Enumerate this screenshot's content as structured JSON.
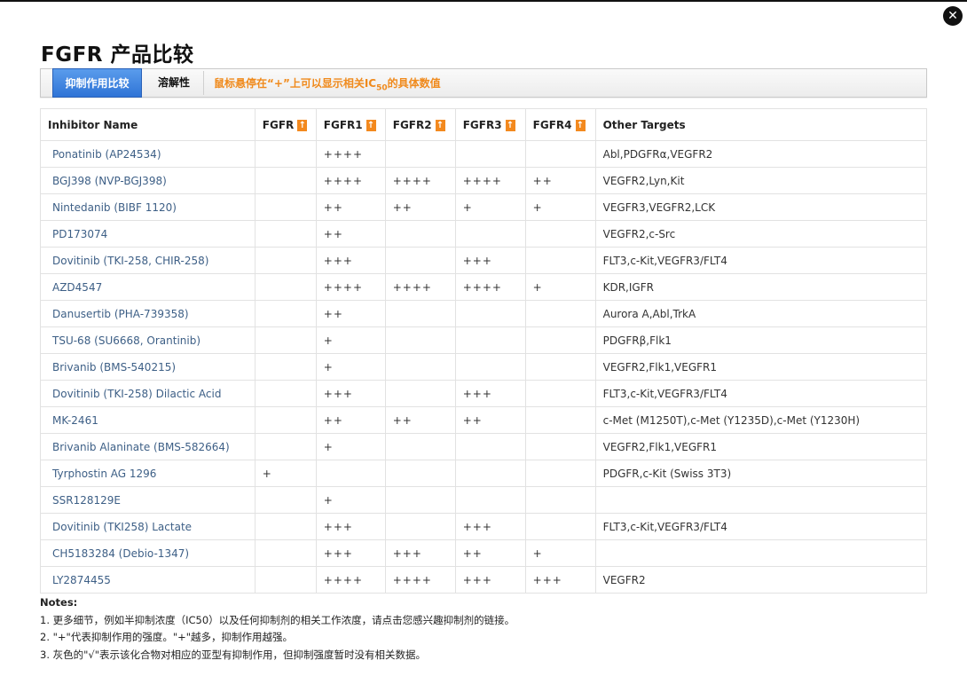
{
  "title": "FGFR 产品比较",
  "close_glyph": "✕",
  "tabs": {
    "active": "抑制作用比较",
    "solubility": "溶解性",
    "hint_prefix": "鼠标悬停在“+”上可以显示相关IC",
    "hint_sub": "50",
    "hint_suffix": "的具体数值"
  },
  "sort_glyph": "↑",
  "table": {
    "headers": [
      "Inhibitor Name",
      "FGFR",
      "FGFR1",
      "FGFR2",
      "FGFR3",
      "FGFR4",
      "Other Targets"
    ],
    "rows": [
      {
        "name": "Ponatinib (AP24534)",
        "fgfr": "",
        "fgfr1": "++++",
        "fgfr2": "",
        "fgfr3": "",
        "fgfr4": "",
        "other": "Abl,PDGFRα,VEGFR2"
      },
      {
        "name": "BGJ398 (NVP-BGJ398)",
        "fgfr": "",
        "fgfr1": "++++",
        "fgfr2": "++++",
        "fgfr3": "++++",
        "fgfr4": "++",
        "other": "VEGFR2,Lyn,Kit"
      },
      {
        "name": "Nintedanib (BIBF 1120)",
        "fgfr": "",
        "fgfr1": "++",
        "fgfr2": "++",
        "fgfr3": "+",
        "fgfr4": "+",
        "other": "VEGFR3,VEGFR2,LCK"
      },
      {
        "name": "PD173074",
        "fgfr": "",
        "fgfr1": "++",
        "fgfr2": "",
        "fgfr3": "",
        "fgfr4": "",
        "other": "VEGFR2,c-Src"
      },
      {
        "name": "Dovitinib (TKI-258, CHIR-258)",
        "fgfr": "",
        "fgfr1": "+++",
        "fgfr2": "",
        "fgfr3": "+++",
        "fgfr4": "",
        "other": "FLT3,c-Kit,VEGFR3/FLT4"
      },
      {
        "name": "AZD4547",
        "fgfr": "",
        "fgfr1": "++++",
        "fgfr2": "++++",
        "fgfr3": "++++",
        "fgfr4": "+",
        "other": "KDR,IGFR"
      },
      {
        "name": "Danusertib (PHA-739358)",
        "fgfr": "",
        "fgfr1": "++",
        "fgfr2": "",
        "fgfr3": "",
        "fgfr4": "",
        "other": "Aurora A,Abl,TrkA"
      },
      {
        "name": "TSU-68 (SU6668, Orantinib)",
        "fgfr": "",
        "fgfr1": "+",
        "fgfr2": "",
        "fgfr3": "",
        "fgfr4": "",
        "other": "PDGFRβ,Flk1"
      },
      {
        "name": "Brivanib (BMS-540215)",
        "fgfr": "",
        "fgfr1": "+",
        "fgfr2": "",
        "fgfr3": "",
        "fgfr4": "",
        "other": "VEGFR2,Flk1,VEGFR1"
      },
      {
        "name": "Dovitinib (TKI-258) Dilactic Acid",
        "fgfr": "",
        "fgfr1": "+++",
        "fgfr2": "",
        "fgfr3": "+++",
        "fgfr4": "",
        "other": "FLT3,c-Kit,VEGFR3/FLT4"
      },
      {
        "name": "MK-2461",
        "fgfr": "",
        "fgfr1": "++",
        "fgfr2": "++",
        "fgfr3": "++",
        "fgfr4": "",
        "other": "c-Met (M1250T),c-Met (Y1235D),c-Met (Y1230H)"
      },
      {
        "name": "Brivanib Alaninate (BMS-582664)",
        "fgfr": "",
        "fgfr1": "+",
        "fgfr2": "",
        "fgfr3": "",
        "fgfr4": "",
        "other": "VEGFR2,Flk1,VEGFR1"
      },
      {
        "name": "Tyrphostin AG 1296",
        "fgfr": "+",
        "fgfr1": "",
        "fgfr2": "",
        "fgfr3": "",
        "fgfr4": "",
        "other": "PDGFR,c-Kit (Swiss 3T3)"
      },
      {
        "name": "SSR128129E",
        "fgfr": "",
        "fgfr1": "+",
        "fgfr2": "",
        "fgfr3": "",
        "fgfr4": "",
        "other": ""
      },
      {
        "name": "Dovitinib (TKI258) Lactate",
        "fgfr": "",
        "fgfr1": "+++",
        "fgfr2": "",
        "fgfr3": "+++",
        "fgfr4": "",
        "other": "FLT3,c-Kit,VEGFR3/FLT4"
      },
      {
        "name": "CH5183284 (Debio-1347)",
        "fgfr": "",
        "fgfr1": "+++",
        "fgfr2": "+++",
        "fgfr3": "++",
        "fgfr4": "+",
        "other": ""
      },
      {
        "name": "LY2874455",
        "fgfr": "",
        "fgfr1": "++++",
        "fgfr2": "++++",
        "fgfr3": "+++",
        "fgfr4": "+++",
        "other": "VEGFR2"
      }
    ]
  },
  "notes": {
    "title": "Notes:",
    "items": [
      "1. 更多细节，例如半抑制浓度（IC50）以及任何抑制剂的相关工作浓度，请点击您感兴趣抑制剂的链接。",
      "2. \"+\"代表抑制作用的强度。\"+\"越多，抑制作用越强。",
      "3. 灰色的\"√\"表示该化合物对相应的亚型有抑制作用，但抑制强度暂时没有相关数据。"
    ]
  },
  "colors": {
    "accent_tab": "#2f74d6",
    "hint_orange": "#f08a1c",
    "link_blue": "#3d5f86",
    "sort_icon": "#f3891e"
  }
}
